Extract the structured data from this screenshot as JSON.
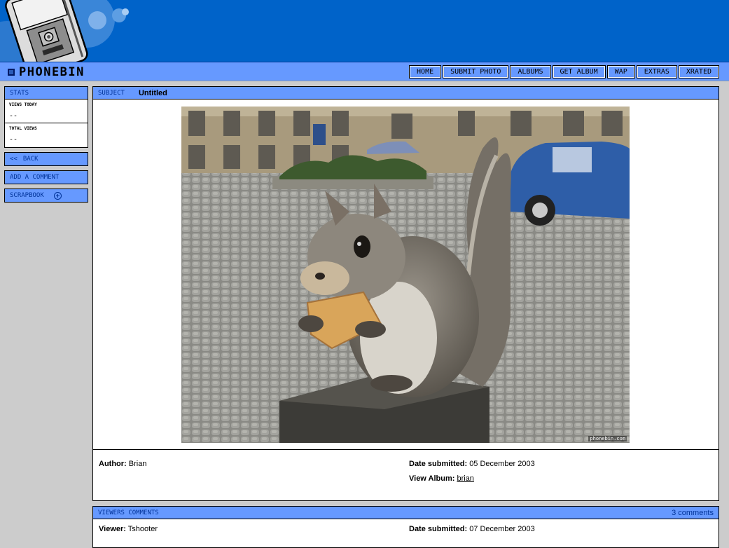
{
  "logo": {
    "text": "PHONEBIN",
    "icon": "square-icon"
  },
  "nav": {
    "items": [
      "HOME",
      "SUBMIT PHOTO",
      "ALBUMS",
      "GET ALBUM",
      "WAP",
      "EXTRAS",
      "XRATED"
    ]
  },
  "sidebar": {
    "stats_title": "STATS",
    "views_today_label": "VIEWS TODAY",
    "views_today_value": "--",
    "total_views_label": "TOTAL VIEWS",
    "total_views_value": "--",
    "back_label": "BACK",
    "back_icon": "<<",
    "comment_label": "ADD A COMMENT",
    "scrapbook_label": "SCRAPBOOK"
  },
  "photo_panel": {
    "subject_label": "SUBJECT",
    "subject_value": "Untitled",
    "watermark": "phonebin.com",
    "author_label": "Author:",
    "author_value": "Brian",
    "date_label": "Date submitted:",
    "date_value": "05 December 2003",
    "album_label": "View Album:",
    "album_value": "brian"
  },
  "comments_panel": {
    "title": "VIEWERS COMMENTS",
    "count": "3 comments",
    "viewer_label": "Viewer:",
    "viewer_value": "Tshooter",
    "date_label": "Date submitted:",
    "date_value": "07 December 2003"
  },
  "colors": {
    "banner": "#0063c9",
    "nav": "#6699ff",
    "page_bg": "#cccccc",
    "accent_text": "#003399"
  }
}
